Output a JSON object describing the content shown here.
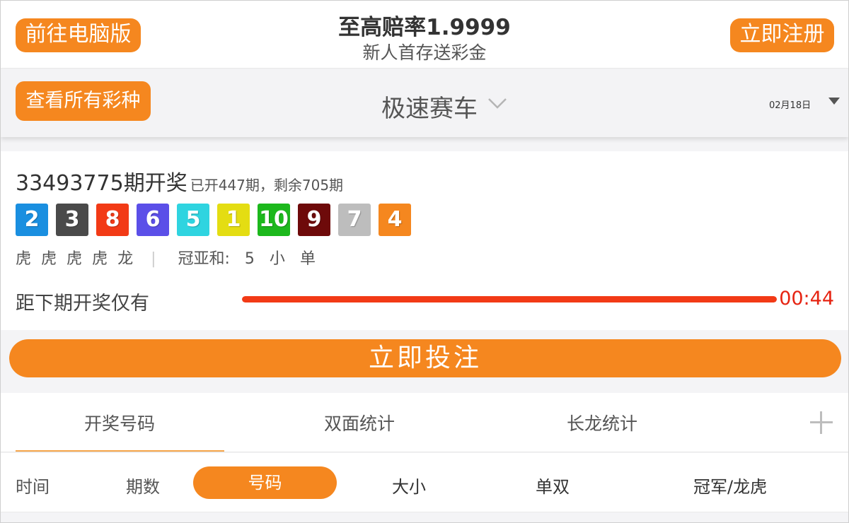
{
  "header": {
    "pc_button_label": "前往电脑版",
    "title": "至高赔率1.9999",
    "subtitle": "新人首存送彩金",
    "register_button_label": "立即注册"
  },
  "selector": {
    "all_lotteries_label": "查看所有彩种",
    "game_name": "极速赛车",
    "date": "02月18日"
  },
  "draw": {
    "issue_title": "33493775期开奖",
    "issue_progress": "已开447期，剩余705期",
    "balls": [
      {
        "value": "2",
        "color": "#1a8fe0"
      },
      {
        "value": "3",
        "color": "#4a4a4a"
      },
      {
        "value": "8",
        "color": "#f23a16"
      },
      {
        "value": "6",
        "color": "#5b4fe8"
      },
      {
        "value": "5",
        "color": "#2fd4e0"
      },
      {
        "value": "1",
        "color": "#e4dd12"
      },
      {
        "value": "10",
        "color": "#1cb81c"
      },
      {
        "value": "9",
        "color": "#6e0a0a"
      },
      {
        "value": "7",
        "color": "#bdbdbd"
      },
      {
        "value": "4",
        "color": "#f5871f"
      }
    ],
    "dragon_tiger": [
      "虎",
      "虎",
      "虎",
      "虎",
      "龙"
    ],
    "separator": "|",
    "sum_label": "冠亚和:",
    "sum_value": "5",
    "sum_size": "小",
    "sum_parity": "单",
    "countdown_label": "距下期开奖仅有",
    "countdown_time": "00:44",
    "countdown_progress": 1.0
  },
  "bet_button_label": "立即投注",
  "tabs": {
    "items": [
      "开奖号码",
      "双面统计",
      "长龙统计"
    ],
    "active_index": 0
  },
  "filters": {
    "items": [
      "时间",
      "期数",
      "号码",
      "大小",
      "单双",
      "冠军/龙虎"
    ],
    "active_index": 2
  },
  "colors": {
    "accent": "#f5871f",
    "countdown_red": "#e62412"
  }
}
